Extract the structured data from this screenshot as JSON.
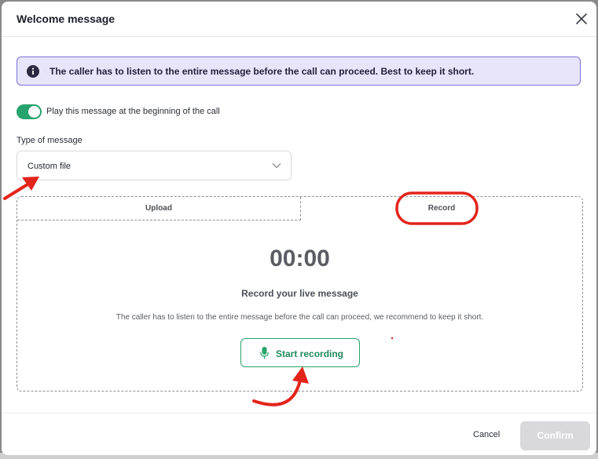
{
  "modal": {
    "title": "Welcome message",
    "close_icon": "close-icon"
  },
  "banner": {
    "icon": "info-icon",
    "text": "The caller has to listen to the entire message before the call can proceed. Best to keep it short."
  },
  "toggle": {
    "on": true,
    "label": "Play this message at the beginning of the call"
  },
  "type_field": {
    "label": "Type of message",
    "value": "Custom file",
    "icon": "chevron-down-icon"
  },
  "tabs": [
    {
      "label": "Upload",
      "active": false
    },
    {
      "label": "Record",
      "active": true
    }
  ],
  "recorder": {
    "timer": "00:00",
    "title": "Record your live message",
    "description": "The caller has to listen to the entire message before the call can proceed, we recommend to keep it short.",
    "start_label": "Start recording",
    "start_icon": "microphone-icon"
  },
  "footer": {
    "cancel_label": "Cancel",
    "confirm_label": "Confirm"
  },
  "colors": {
    "accent_green": "#27a36d",
    "banner_bg": "#e8e5fb",
    "banner_border": "#7b74d6",
    "annotation_red": "#e3241b"
  }
}
